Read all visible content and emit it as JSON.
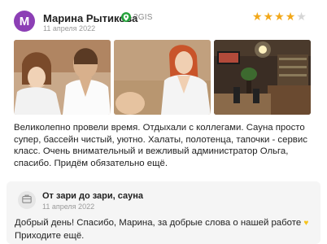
{
  "review": {
    "avatar_letter": "М",
    "avatar_color": "#8c3fb5",
    "author": "Марина Рытикова",
    "source": {
      "icon": "2gis-location-icon",
      "label": "2GIS",
      "color": "#26a33c"
    },
    "date": "11 апреля 2022",
    "rating": 4,
    "rating_max": 5,
    "star_color": "#f2a81a",
    "photos": [
      {
        "icon": "photo-thumbnail"
      },
      {
        "icon": "photo-thumbnail"
      },
      {
        "icon": "photo-thumbnail"
      }
    ],
    "text": "Великолепно провели время. Отдыхали с коллегами. Сауна просто супер, бассейн чистый, уютно. Халаты, полотенца, тапочки - сервис класс. Очень внимательный и вежливый администратор Ольга, спасибо. Придём обязательно ещё."
  },
  "reply": {
    "logo_icon": "briefcase-icon",
    "author": "От зари до зари, сауна",
    "date": "11 апреля 2022",
    "text": "Добрый день! Спасибо, Марина, за добрые слова о нашей работе",
    "text_cont": "Приходите ещё.",
    "emoji": "♥"
  }
}
